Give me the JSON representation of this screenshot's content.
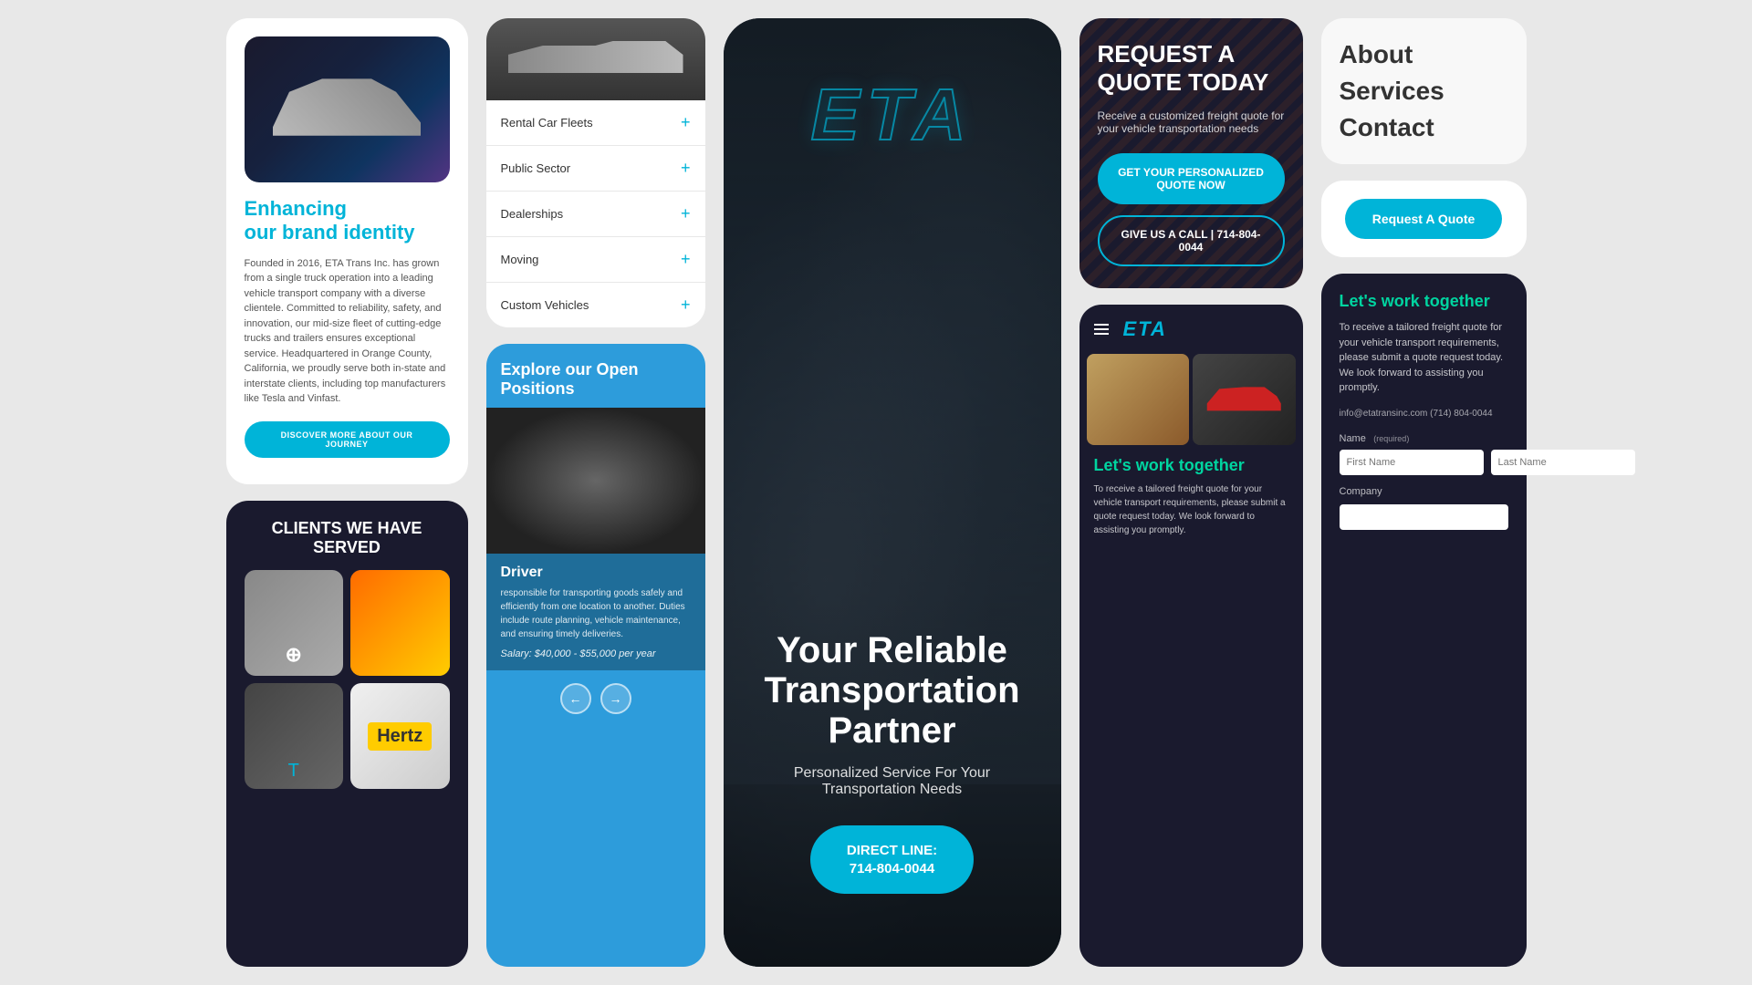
{
  "col1": {
    "about": {
      "brand_title": "Enhancing\nour brand identity",
      "description": "Founded in 2016, ETA Trans Inc. has grown from a single truck operation into a leading vehicle transport company with a diverse clientele. Committed to reliability, safety, and innovation, our mid-size fleet of cutting-edge trucks and trailers ensures exceptional service. Headquartered in Orange County, California, we proudly serve both in-state and interstate clients, including top manufacturers like Tesla and Vinfast.",
      "discover_btn": "DISCOVER MORE ABOUT OUR JOURNEY"
    },
    "clients": {
      "title": "CLIENTS WE HAVE\nSERVED"
    }
  },
  "col2": {
    "accordion": {
      "items": [
        {
          "label": "Rental Car Fleets",
          "plus": "+"
        },
        {
          "label": "Public Sector",
          "plus": "+"
        },
        {
          "label": "Dealerships",
          "plus": "+"
        },
        {
          "label": "Moving",
          "plus": "+"
        },
        {
          "label": "Custom Vehicles",
          "plus": "+"
        }
      ]
    },
    "jobs": {
      "title": "Explore our Open Positions",
      "driver_title": "Driver",
      "driver_desc": "responsible for transporting goods safely and efficiently from one location to another. Duties include route planning, vehicle maintenance, and ensuring timely deliveries.",
      "driver_salary": "Salary: $40,000 - $55,000 per year"
    }
  },
  "col3": {
    "hero": {
      "logo": "ETA",
      "title": "Your Reliable Transportation Partner",
      "subtitle": "Personalized Service For Your Transportation Needs",
      "direct_btn_line1": "DIRECT LINE:",
      "direct_btn_line2": "714-804-0044"
    }
  },
  "col4": {
    "quote": {
      "title": "REQUEST A QUOTE TODAY",
      "desc": "Receive a customized freight quote for your vehicle transportation needs",
      "get_quote_btn": "GET YOUR PERSONALIZED QUOTE NOW",
      "call_btn": "GIVE US A CALL | 714-804-0044"
    },
    "services_phone": {
      "logo": "ETA",
      "work_title": "Let's work together",
      "desc": "To receive a tailored freight quote for your vehicle transport requirements, please submit a quote request today. We look forward to assisting you promptly."
    }
  },
  "col5": {
    "nav": {
      "about": "About",
      "services": "Services",
      "contact": "Contact"
    },
    "form": {
      "req_btn": "Request A Quote",
      "work_title": "Let's work together",
      "desc": "To receive a tailored freight quote for your vehicle transport requirements, please submit a quote request today. We look forward to assisting you promptly.",
      "email": "info@etatransinc.com (714) 804-0044",
      "name_label": "Name",
      "required_tag": "(required)",
      "first_name_label": "First Name",
      "last_name_label": "Last Name",
      "company_label": "Company"
    }
  }
}
